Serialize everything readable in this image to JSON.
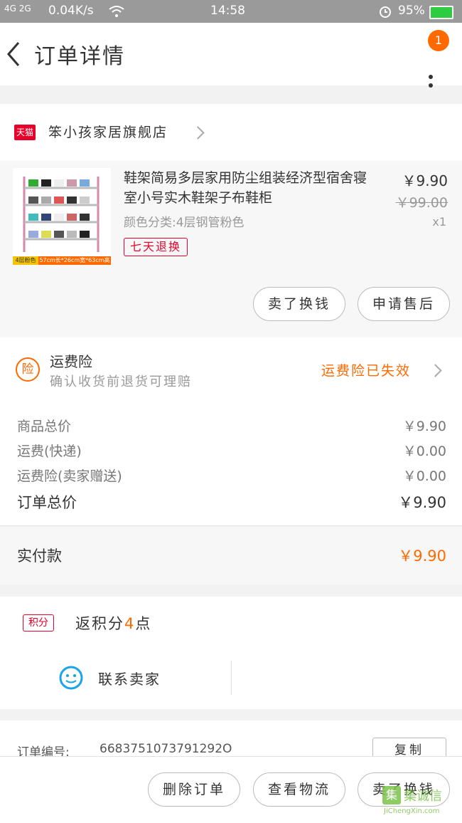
{
  "status": {
    "signal": "4G  2G",
    "speed": "0.04K/s",
    "time": "14:58",
    "battery": "95%"
  },
  "nav": {
    "title": "订单详情",
    "badge": "1"
  },
  "store": {
    "platform_badge": "天猫",
    "name": "笨小孩家居旗舰店"
  },
  "product": {
    "title": "鞋架简易多层家用防尘组装经济型宿舍寝室小号实木鞋架子布鞋柜",
    "sku": "颜色分类:4层钢管粉色",
    "tag": "七天退换",
    "price": "￥9.90",
    "original_price": "￥99.00",
    "quantity": "x1",
    "image_caption_left": "4层粉色",
    "image_caption_right": "57cm长*26cm宽*63cm高"
  },
  "item_actions": [
    "卖了换钱",
    "申请售后"
  ],
  "insurance": {
    "icon": "险",
    "title": "运费险",
    "subtitle": "确认收货前退货可理赔",
    "status": "运费险已失效"
  },
  "costs": [
    {
      "label": "商品总价",
      "value": "￥9.90"
    },
    {
      "label": "运费(快递)",
      "value": "￥0.00"
    },
    {
      "label": "运费险(卖家赠送)",
      "value": "￥0.00"
    }
  ],
  "order_total": {
    "label": "订单总价",
    "value": "￥9.90"
  },
  "paid": {
    "label": "实付款",
    "value": "￥9.90"
  },
  "points": {
    "badge": "积分",
    "text_prefix": "返积分",
    "number": "4",
    "text_suffix": "点"
  },
  "contact": {
    "label": "联系卖家"
  },
  "order_no": {
    "label": "订单编号:",
    "value": "6683751073791292O",
    "copy": "复制"
  },
  "bottom_actions": [
    "删除订单",
    "查看物流",
    "卖了换钱"
  ],
  "watermark": {
    "name": "集诚信",
    "domain": "JiChengXin.com"
  },
  "colors": {
    "accent": "#ff6a00",
    "tmall": "#e6002a"
  }
}
